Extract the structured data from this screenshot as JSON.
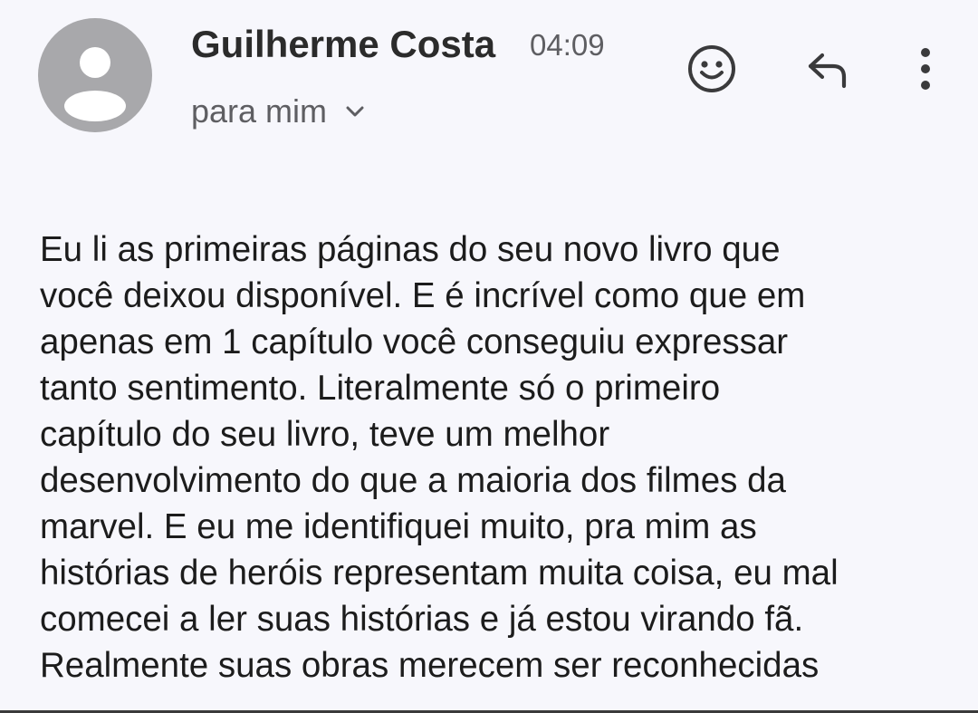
{
  "header": {
    "sender_name": "Guilherme Costa",
    "time": "04:09",
    "recipient_label": "para mim",
    "icons": {
      "avatar": "person-avatar-icon",
      "recipient_toggle": "chevron-down-icon",
      "react": "emoji-smile-icon",
      "reply": "reply-icon",
      "more": "more-vert-icon"
    }
  },
  "message": {
    "body": "Eu li as primeiras páginas do seu novo livro que\nvocê deixou disponível. E é incrível como que em\napenas em 1 capítulo você conseguiu expressar\ntanto sentimento. Literalmente só o primeiro\ncapítulo do seu livro, teve um melhor\ndesenvolvimento do que a maioria dos filmes da\nmarvel. E eu me identifiquei muito, pra mim as\nhistórias de heróis representam muita coisa, eu mal\ncomecei a ler suas histórias e já estou virando fã.\nRealmente suas obras merecem ser reconhecidas"
  },
  "colors": {
    "background": "#f7f7fc",
    "avatar": "#a8a8ab",
    "text": "#1c1c1c",
    "secondary_text": "#5e5e62"
  }
}
